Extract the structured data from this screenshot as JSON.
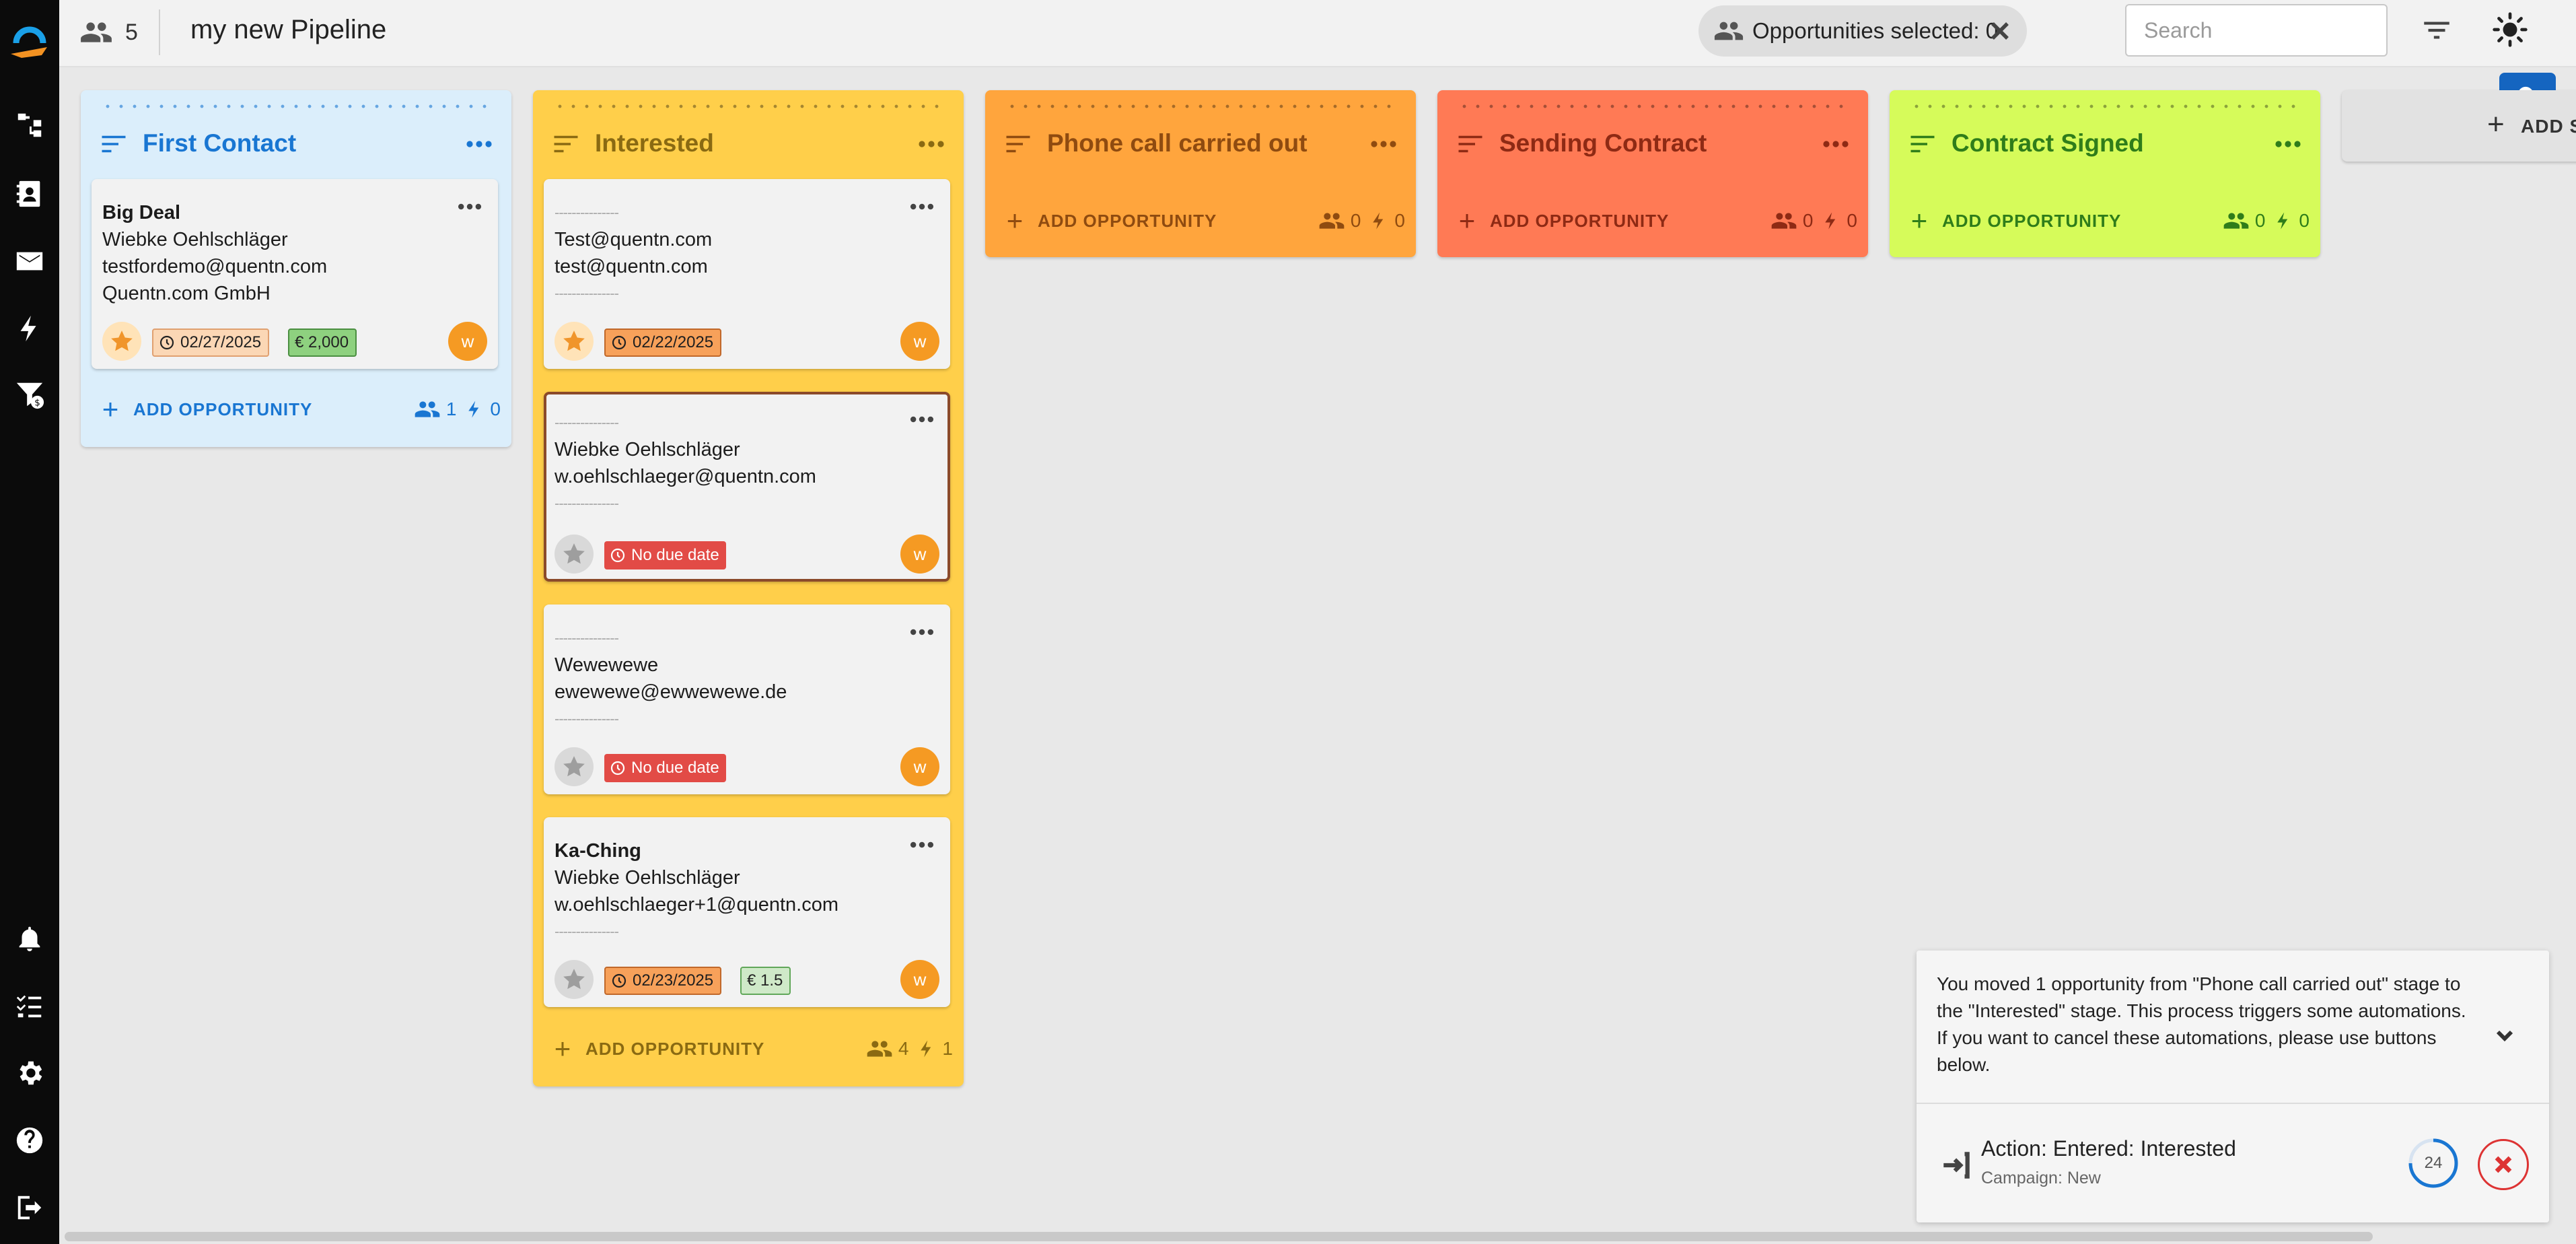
{
  "topbar": {
    "member_count": "5",
    "pipeline_title": "my new Pipeline",
    "opportunities_selected": "Opportunities selected: 0",
    "search_placeholder": "Search"
  },
  "colors": {
    "sidebar": "#0b0b0b",
    "first_contact": "#dbeefb",
    "interested": "#ffcf4a",
    "phone_call": "#ffa53d",
    "sending_contract": "#ff7a55",
    "contract_signed": "#d6fb5a"
  },
  "columns": [
    {
      "title": "First Contact",
      "add_label": "ADD OPPORTUNITY",
      "contacts": "1",
      "automations": "0",
      "cards": [
        {
          "lines": [
            "Big Deal",
            "Wiebke Oehlschläger",
            "testfordemo@quentn.com",
            "Quentn.com GmbH"
          ],
          "date": "02/27/2025",
          "amount": "€ 2,000",
          "avatar": "w"
        }
      ]
    },
    {
      "title": "Interested",
      "add_label": "ADD OPPORTUNITY",
      "contacts": "4",
      "automations": "1",
      "cards": [
        {
          "lines": [
            "---------------",
            "Test@quentn.com",
            "test@quentn.com",
            "---------------"
          ],
          "date": "02/22/2025",
          "avatar": "w"
        },
        {
          "lines": [
            "---------------",
            "Wiebke Oehlschläger",
            "w.oehlschlaeger@quentn.com",
            "---------------"
          ],
          "date": "No due date",
          "avatar": "w"
        },
        {
          "lines": [
            "---------------",
            "Wewewewe",
            "ewewewe@ewwewewe.de",
            "---------------"
          ],
          "date": "No due date",
          "avatar": "w"
        },
        {
          "lines": [
            "Ka-Ching",
            "Wiebke Oehlschläger",
            "w.oehlschlaeger+1@quentn.com",
            "---------------"
          ],
          "date": "02/23/2025",
          "amount": "€ 1.5",
          "avatar": "w"
        }
      ]
    },
    {
      "title": "Phone call carried out",
      "add_label": "ADD OPPORTUNITY",
      "contacts": "0",
      "automations": "0"
    },
    {
      "title": "Sending Contract",
      "add_label": "ADD OPPORTUNITY",
      "contacts": "0",
      "automations": "0"
    },
    {
      "title": "Contract Signed",
      "add_label": "ADD OPPORTUNITY",
      "contacts": "0",
      "automations": "0"
    }
  ],
  "add_stage_label": "ADD S",
  "notification": {
    "message": "You moved 1 opportunity from \"Phone call carried out\" stage to the \"Interested\" stage. This process triggers some automations. If you want to cancel these automations, please use buttons below.",
    "action": "Action: Entered: Interested",
    "campaign": "Campaign: New",
    "countdown": "24"
  }
}
